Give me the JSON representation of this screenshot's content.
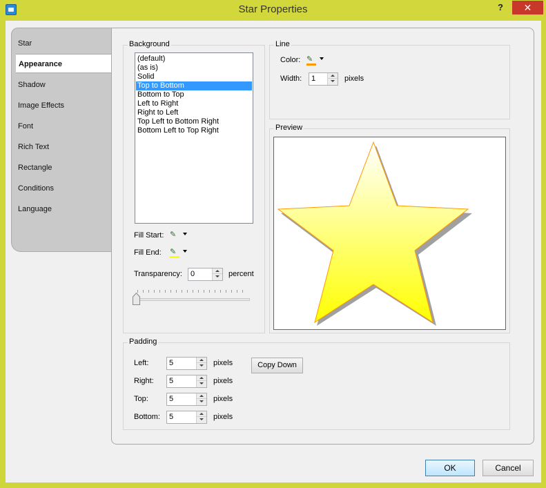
{
  "window": {
    "title": "Star Properties",
    "help_label": "?",
    "close_label": "✕"
  },
  "tabs": [
    {
      "label": "Star",
      "active": false
    },
    {
      "label": "Appearance",
      "active": true
    },
    {
      "label": "Shadow",
      "active": false
    },
    {
      "label": "Image Effects",
      "active": false
    },
    {
      "label": "Font",
      "active": false
    },
    {
      "label": "Rich Text",
      "active": false
    },
    {
      "label": "Rectangle",
      "active": false
    },
    {
      "label": "Conditions",
      "active": false
    },
    {
      "label": "Language",
      "active": false
    }
  ],
  "background": {
    "group_label": "Background",
    "options": [
      "(default)",
      "(as is)",
      "Solid",
      "Top to Bottom",
      "Bottom to Top",
      "Left to Right",
      "Right to Left",
      "Top Left to Bottom Right",
      "Bottom Left to Top Right"
    ],
    "selected_index": 3,
    "fill_start_label": "Fill Start:",
    "fill_end_label": "Fill End:",
    "fill_end_color": "#ffff00",
    "transparency_label": "Transparency:",
    "transparency_value": "0",
    "transparency_unit": "percent",
    "transparency_level": 0
  },
  "line": {
    "group_label": "Line",
    "color_label": "Color:",
    "color": "#ff9900",
    "width_label": "Width:",
    "width_value": "1",
    "width_unit": "pixels"
  },
  "preview": {
    "group_label": "Preview",
    "fill_top_color": "#ffffff",
    "fill_bottom_color": "#ffff00",
    "outline_color": "#ff9900",
    "shadow_color": "#a0a0a0"
  },
  "padding": {
    "group_label": "Padding",
    "left_label": "Left:",
    "left_value": "5",
    "right_label": "Right:",
    "right_value": "5",
    "top_label": "Top:",
    "top_value": "5",
    "bottom_label": "Bottom:",
    "bottom_value": "5",
    "unit": "pixels",
    "copy_down_label": "Copy Down"
  },
  "footer": {
    "ok_label": "OK",
    "cancel_label": "Cancel"
  }
}
